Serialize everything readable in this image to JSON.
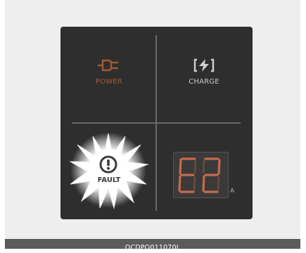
{
  "panel": {
    "power": {
      "label": "POWER",
      "icon": "plug-icon",
      "color": "#a25a37"
    },
    "charge": {
      "label": "CHARGE",
      "icon": "lightning-bracket-icon",
      "color": "#c8c8c8"
    },
    "fault": {
      "label": "FAULT",
      "icon": "exclamation-circle-icon",
      "state": "lit",
      "glow_color": "#ffffff"
    },
    "display": {
      "value": "E2",
      "unit": "A",
      "segment_color": "#c76a4c"
    }
  },
  "footer": {
    "caption": "OCDPQ011070L"
  }
}
